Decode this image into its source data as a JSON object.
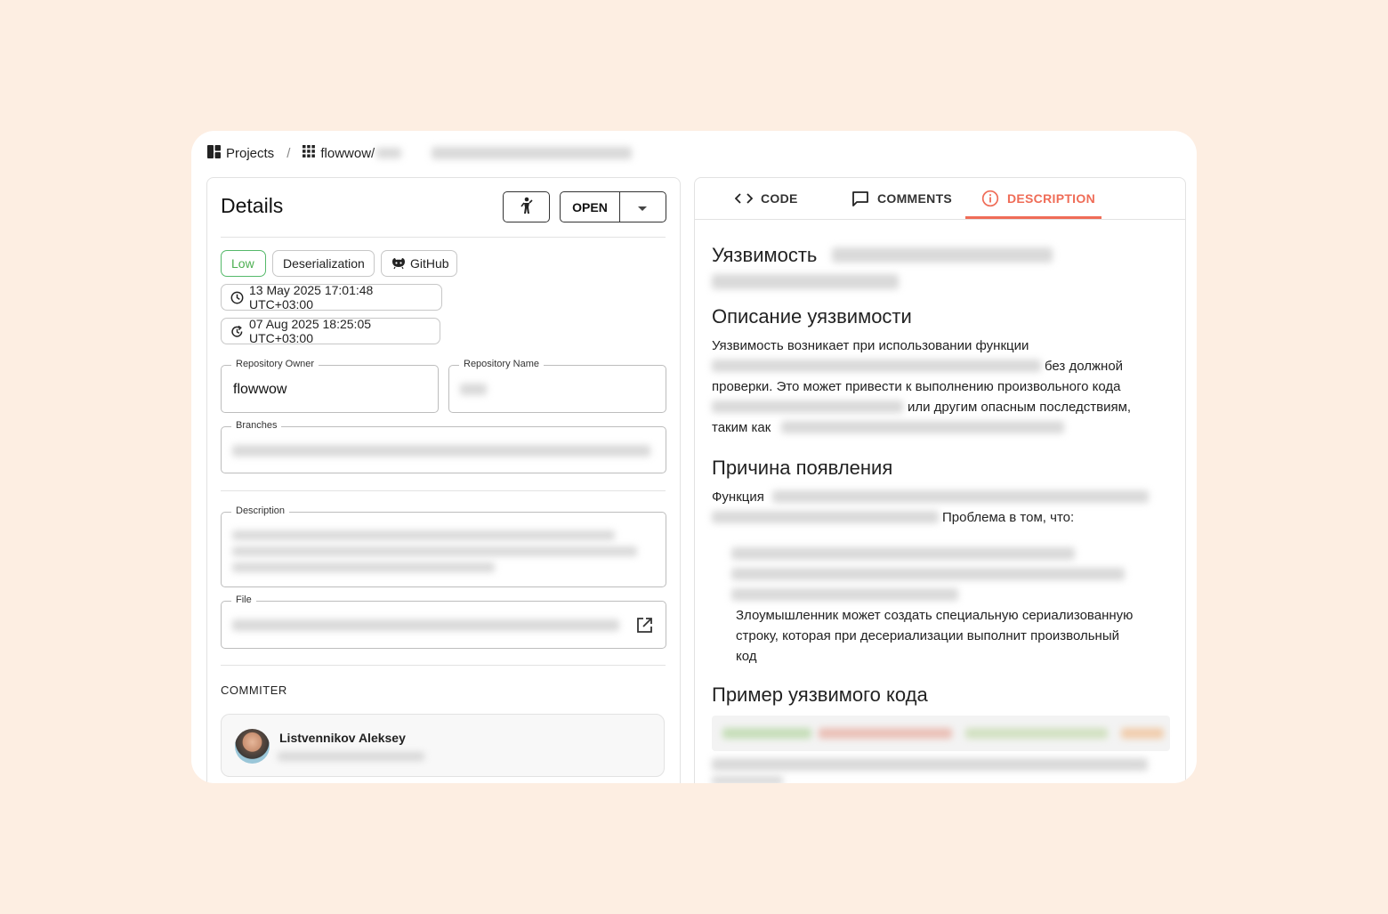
{
  "breadcrumb": {
    "projects_label": "Projects",
    "separator": "/",
    "repo_label": "flowwow/"
  },
  "details": {
    "title": "Details",
    "status_button": "OPEN",
    "tags": {
      "severity": "Low",
      "category": "Deserialization",
      "source": "GitHub"
    },
    "created_at": "13 May 2025 17:01:48 UTC+03:00",
    "updated_at": "07 Aug 2025 18:25:05 UTC+03:00",
    "repository_owner_label": "Repository Owner",
    "repository_owner_value": "flowwow",
    "repository_name_label": "Repository Name",
    "branches_label": "Branches",
    "description_label": "Description",
    "file_label": "File",
    "commiter_section": "COMMITER",
    "commiter_name": "Listvennikov Aleksey"
  },
  "tabs": {
    "code": "CODE",
    "comments": "COMMENTS",
    "description": "DESCRIPTION"
  },
  "description_panel": {
    "vuln_heading": "Уязвимость",
    "desc_heading": "Описание уязвимости",
    "desc_text_1": "Уязвимость возникает при использовании функции",
    "desc_text_2": "без должной",
    "desc_text_3": "проверки. Это может привести к выполнению произвольного кода",
    "desc_text_4": "или другим опасным последствиям,",
    "desc_text_5": "таким как",
    "cause_heading": "Причина появления",
    "cause_text_1": "Функция",
    "cause_text_2": "Проблема в том, что:",
    "cause_bullet_1": "Злоумышленник может создать специальную сериализованную",
    "cause_bullet_2": "строку, которая при десериализации выполнит произвольный",
    "cause_bullet_3": "код",
    "example_heading": "Пример уязвимого кода"
  },
  "colors": {
    "background": "#fdeee2",
    "accent": "#ef6c57",
    "low_severity": "#4caf50"
  },
  "icons": {
    "projects": "dashboard-icon",
    "repo": "grid-icon",
    "assign": "person-icon",
    "dropdown": "caret-down-icon",
    "github": "github-icon",
    "created": "clock-icon",
    "updated": "history-icon",
    "external_link": "open-in-new-icon",
    "code_tab": "code-icon",
    "comments_tab": "comment-icon",
    "description_tab": "info-icon"
  }
}
